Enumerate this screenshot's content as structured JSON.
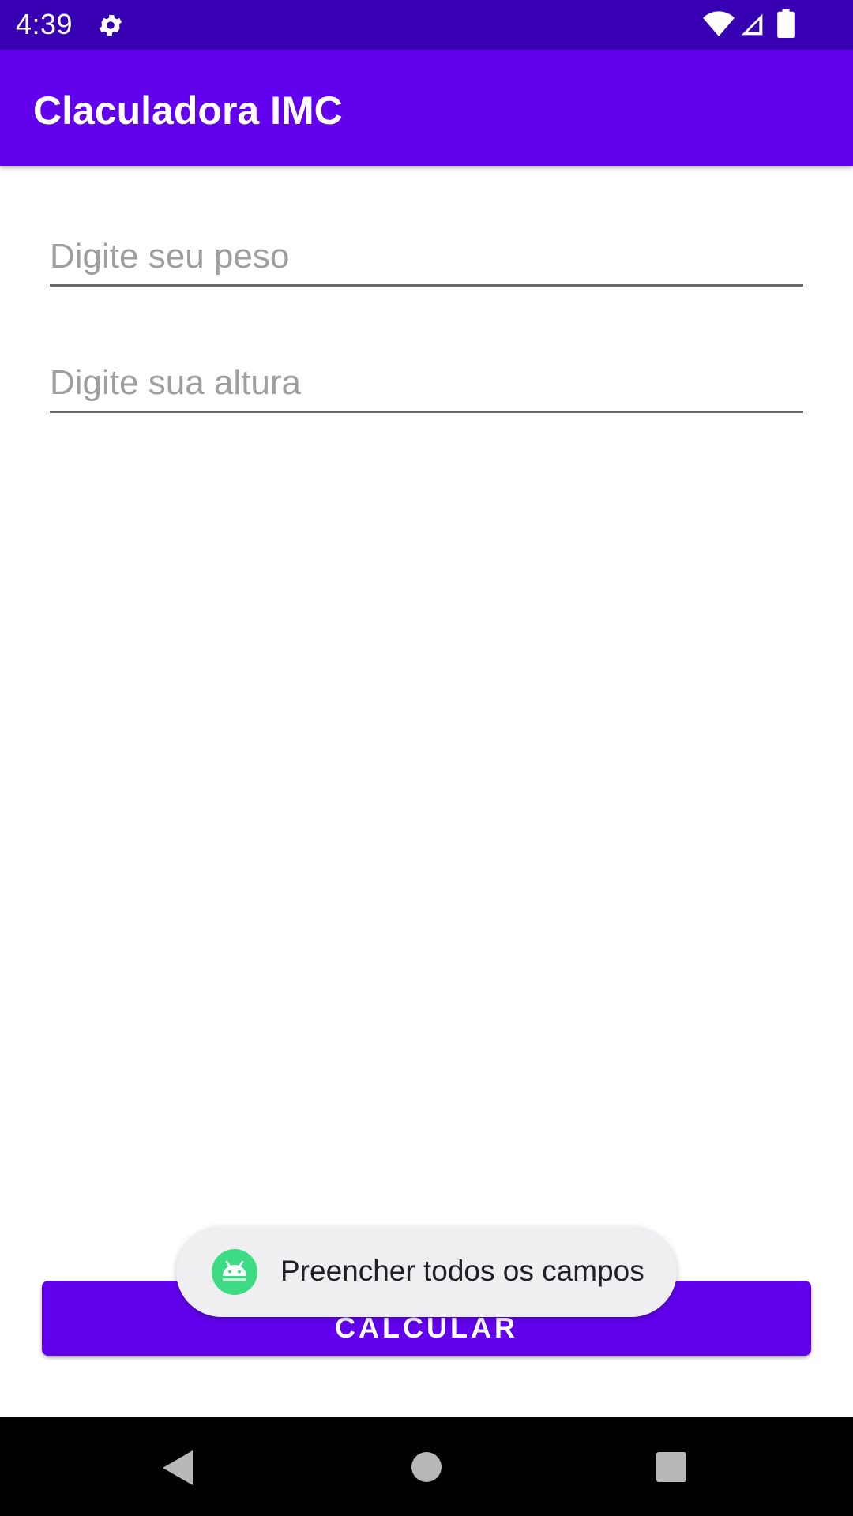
{
  "status_bar": {
    "time": "4:39",
    "icons": [
      "gear-icon",
      "wifi-icon",
      "signal-icon",
      "battery-icon"
    ]
  },
  "app_bar": {
    "title": "Claculadora IMC",
    "color": "#6200ee"
  },
  "form": {
    "weight_placeholder": "Digite seu peso",
    "weight_value": "",
    "height_placeholder": "Digite sua altura",
    "height_value": "",
    "calculate_label": "CALCULAR"
  },
  "toast": {
    "message": "Preencher todos os campos",
    "icon": "android-icon"
  },
  "nav_bar": {
    "icons": [
      "back-icon",
      "home-icon",
      "recents-icon"
    ]
  },
  "colors": {
    "primary": "#6200ee",
    "primary_dark": "#3700b3",
    "toast_bg": "#efeff2",
    "android_green": "#3ddc84"
  }
}
